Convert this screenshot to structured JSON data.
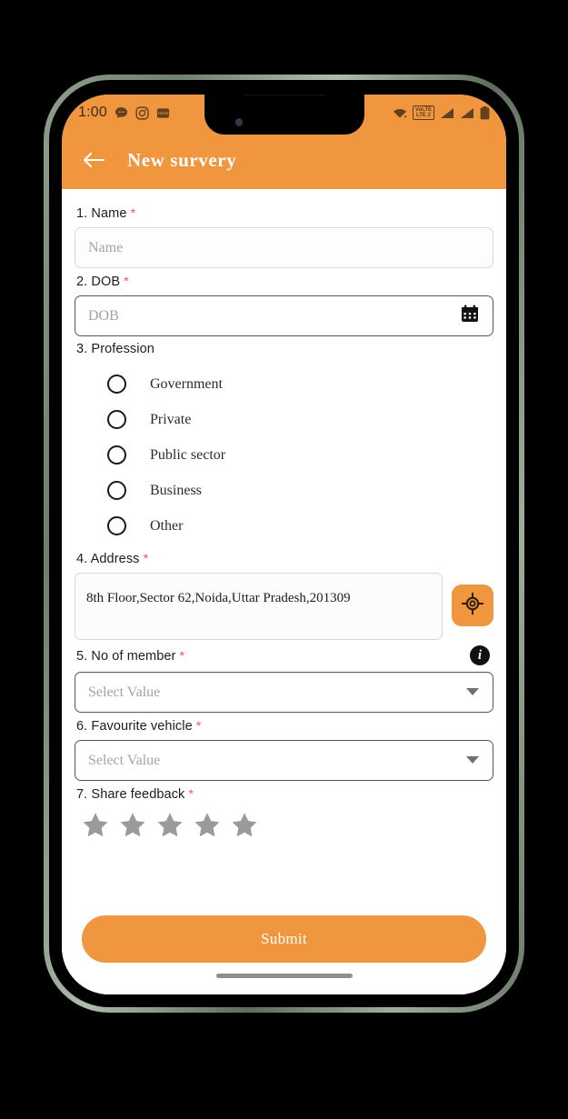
{
  "status_bar": {
    "time": "1:00",
    "left_icons": [
      "messages-icon",
      "instagram-icon",
      "notification-icon"
    ],
    "network_label": "VoLTE",
    "network_label2": "LTE 2",
    "right_icons": [
      "wifi-icon",
      "volte-icon",
      "signal-icon-1",
      "signal-icon-2",
      "battery-icon"
    ]
  },
  "app_bar": {
    "back_icon": "back-arrow-icon",
    "title": "New survery"
  },
  "theme": {
    "accent": "#F0963F",
    "required_asterisk": "#f0564b",
    "star_inactive": "#9a9a9a"
  },
  "form": {
    "fields": [
      {
        "number": "1.",
        "label": "1. Name",
        "required": "*",
        "type": "text",
        "placeholder": "Name",
        "value": ""
      },
      {
        "number": "2.",
        "label": "2. DOB",
        "required": "*",
        "type": "date",
        "placeholder": "DOB",
        "value": "",
        "icon": "calendar-icon"
      },
      {
        "number": "3.",
        "label": "3. Profession",
        "required": "",
        "type": "radio",
        "options": [
          "Government",
          "Private",
          "Public sector",
          "Business",
          "Other"
        ],
        "selected": ""
      },
      {
        "number": "4.",
        "label": "4. Address",
        "required": "*",
        "type": "textarea",
        "value": "8th Floor,Sector 62,Noida,Uttar Pradesh,201309",
        "action_icon": "gps-locate-icon"
      },
      {
        "number": "5.",
        "label": "5. No of member",
        "required": "*",
        "type": "select",
        "placeholder": "Select Value",
        "value": "",
        "info_icon": "info-icon",
        "info_glyph": "i"
      },
      {
        "number": "6.",
        "label": "6. Favourite vehicle",
        "required": "*",
        "type": "select",
        "placeholder": "Select Value",
        "value": ""
      },
      {
        "number": "7.",
        "label": "7. Share feedback",
        "required": "*",
        "type": "rating",
        "max": 5,
        "value": 0
      }
    ],
    "submit_label": "Submit"
  }
}
